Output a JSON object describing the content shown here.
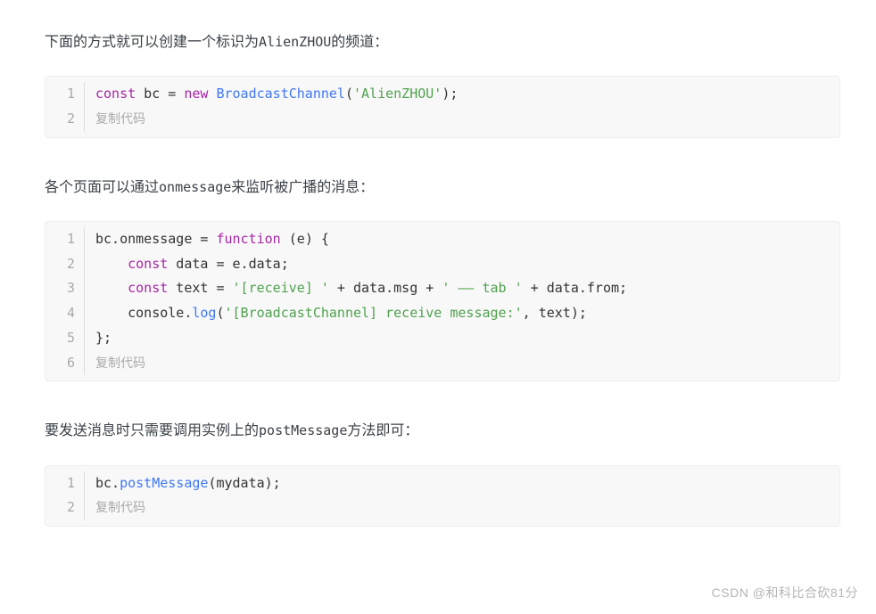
{
  "para1": {
    "pre": "下面的方式就可以创建一个标识为",
    "mono": "AlienZHOU",
    "post": "的频道："
  },
  "code1": {
    "lines": [
      "1",
      "2"
    ],
    "l1": {
      "t0": "const",
      "t1": " bc = ",
      "t2": "new",
      "t3": " ",
      "t4": "BroadcastChannel",
      "t5": "(",
      "t6": "'AlienZHOU'",
      "t7": ");"
    },
    "copy": "复制代码"
  },
  "para2": {
    "pre": "各个页面可以通过",
    "mono": "onmessage",
    "post": "来监听被广播的消息："
  },
  "code2": {
    "lines": [
      "1",
      "2",
      "3",
      "4",
      "5",
      "6"
    ],
    "l1": {
      "t0": "bc.onmessage = ",
      "t1": "function",
      "t2": " (",
      "t3": "e",
      "t4": ") {"
    },
    "l2": {
      "t0": "    ",
      "t1": "const",
      "t2": " data = e.data;"
    },
    "l3": {
      "t0": "    ",
      "t1": "const",
      "t2": " text = ",
      "t3": "'[receive] '",
      "t4": " + data.msg + ",
      "t5": "' —— tab '",
      "t6": " + data.from;"
    },
    "l4": {
      "t0": "    console.",
      "t1": "log",
      "t2": "(",
      "t3": "'[BroadcastChannel] receive message:'",
      "t4": ", text);"
    },
    "l5": {
      "t0": "};"
    },
    "copy": "复制代码"
  },
  "para3": {
    "pre": "要发送消息时只需要调用实例上的",
    "mono": "postMessage",
    "post": "方法即可："
  },
  "code3": {
    "lines": [
      "1",
      "2"
    ],
    "l1": {
      "t0": "bc.",
      "t1": "postMessage",
      "t2": "(mydata);"
    },
    "copy": "复制代码"
  },
  "watermark": "CSDN @和科比合砍81分"
}
